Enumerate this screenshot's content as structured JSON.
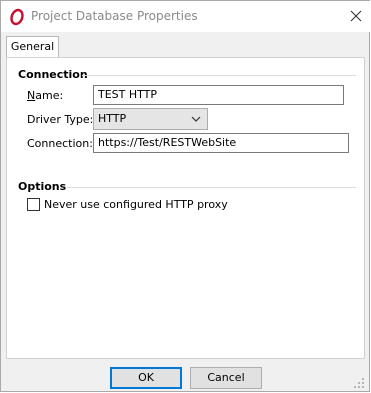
{
  "window": {
    "title": "Project Database Properties"
  },
  "tabs": [
    {
      "label": "General"
    }
  ],
  "connection": {
    "section_title": "Connection",
    "name": {
      "label_accel": "N",
      "label_rest": "ame:",
      "value": "TEST HTTP"
    },
    "driver_type": {
      "label": "Driver Type:",
      "value": "HTTP"
    },
    "connection": {
      "label": "Connection:",
      "value": "https://Test/RESTWebSite"
    }
  },
  "options": {
    "section_title": "Options",
    "proxy_checkbox": {
      "label": "Never use configured HTTP proxy",
      "checked": false
    }
  },
  "buttons": {
    "ok": "OK",
    "cancel": "Cancel"
  },
  "colors": {
    "accent": "#0078d7",
    "brand_icon": "#c8102e"
  }
}
